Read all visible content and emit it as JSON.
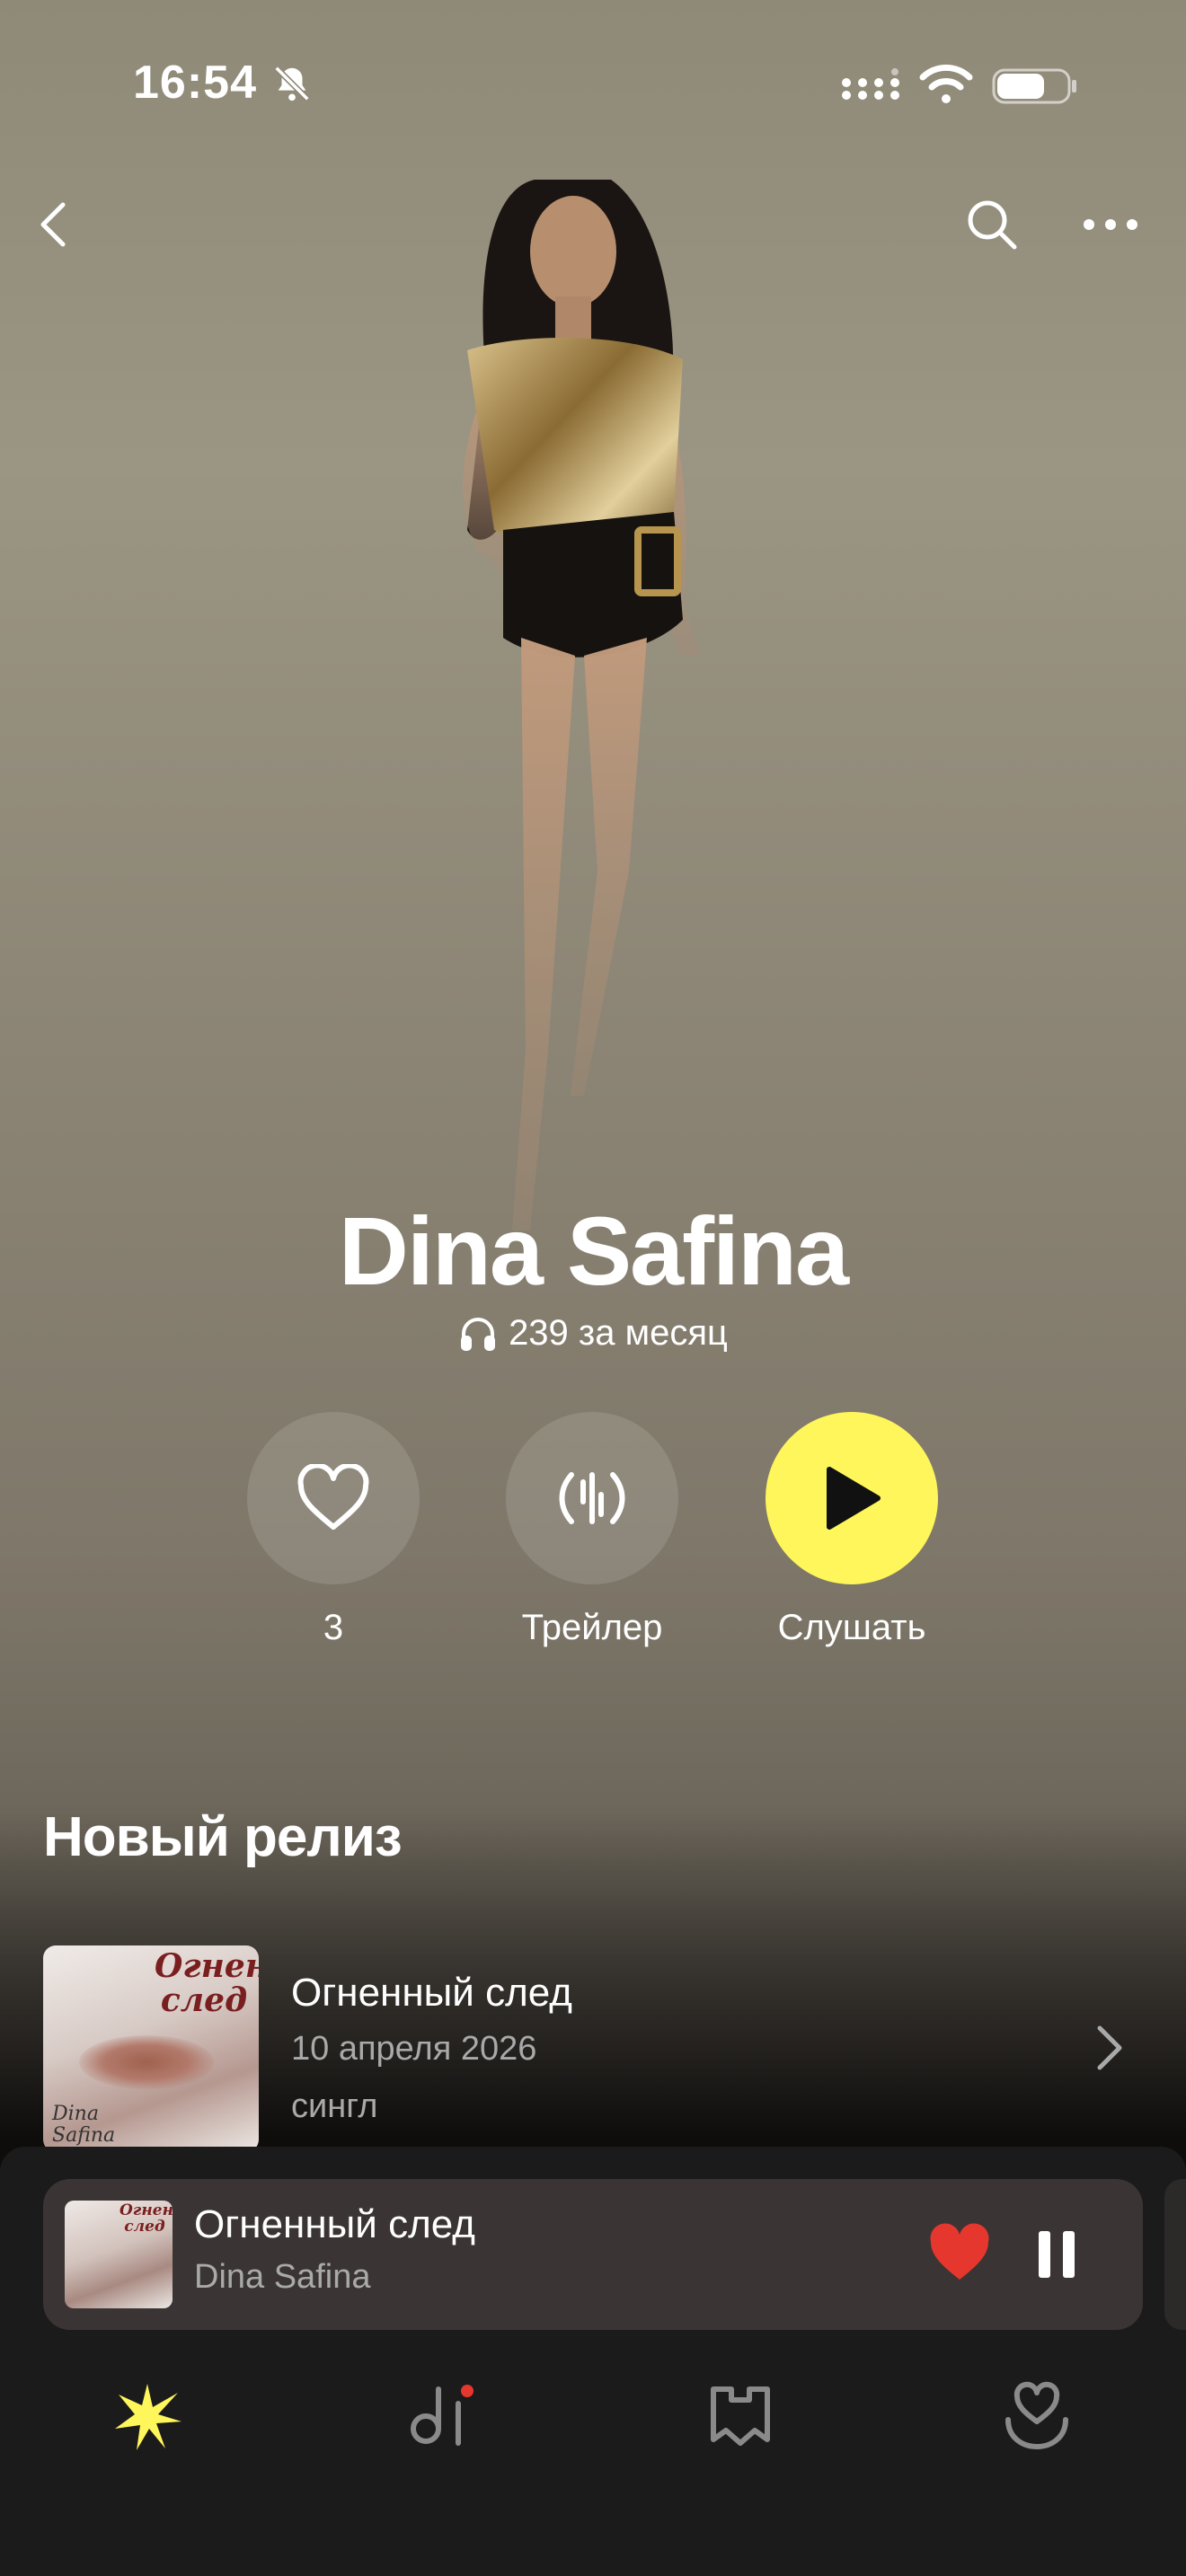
{
  "status_bar": {
    "time": "16:54",
    "icons": [
      "bell-slash-icon",
      "signal-icon",
      "wifi-icon",
      "battery-icon"
    ]
  },
  "nav": {
    "icons": [
      "back-icon",
      "search-icon",
      "more-icon"
    ]
  },
  "artist": {
    "name": "Dina Safina",
    "listeners": "239 за месяц",
    "listeners_icon": "headphones-icon"
  },
  "actions": [
    {
      "label": "3",
      "icon": "heart-outline-icon"
    },
    {
      "label": "Трейлер",
      "icon": "waveform-icon"
    },
    {
      "label": "Слушать",
      "icon": "play-icon"
    }
  ],
  "colors": {
    "accent_yellow": "#fef65b",
    "like_red": "#e6372e"
  },
  "new_release": {
    "section_title": "Новый релиз",
    "cover_title": "Огненный след",
    "cover_artist": "Dina Safina",
    "title": "Огненный след",
    "date": "10 апреля 2026",
    "type": "сингл"
  },
  "mini_player": {
    "cover_title": "Огненный след",
    "cover_artist": "Dina Safina",
    "title": "Огненный след",
    "artist": "Dina Safina",
    "liked": true
  },
  "tab_bar": {
    "items": [
      {
        "name": "main",
        "icon": "sparkle-icon",
        "active": true
      },
      {
        "name": "charts",
        "icon": "music-notification-icon",
        "badge": true
      },
      {
        "name": "collection",
        "icon": "bookmark-map-icon"
      },
      {
        "name": "favorites",
        "icon": "heart-hand-icon"
      }
    ]
  }
}
